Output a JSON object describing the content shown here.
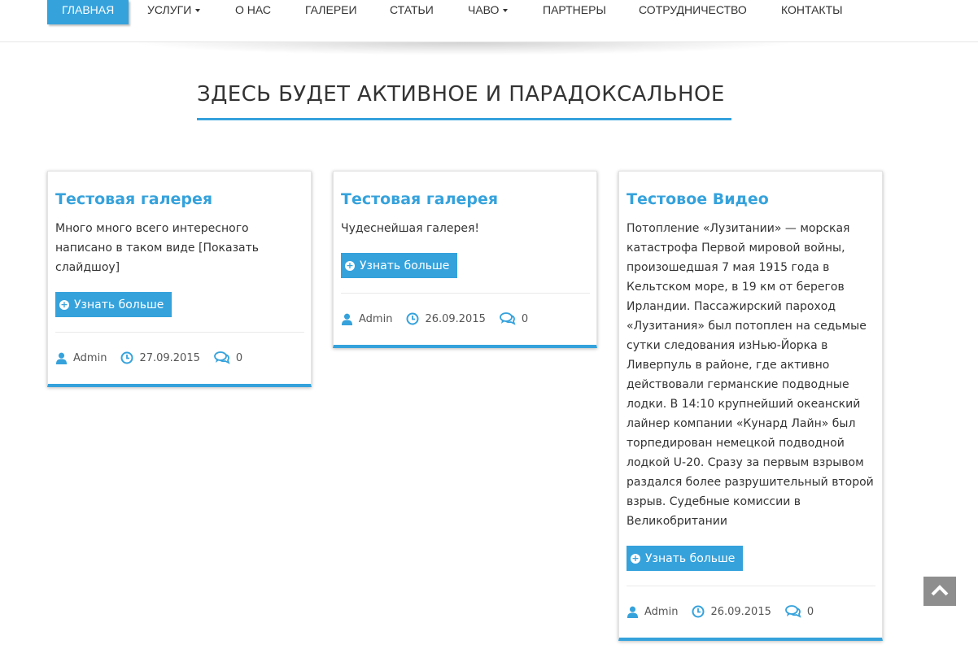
{
  "nav": {
    "items": [
      {
        "label": "ГЛАВНАЯ",
        "active": true,
        "dropdown": false
      },
      {
        "label": "УСЛУГИ",
        "active": false,
        "dropdown": true
      },
      {
        "label": "О НАС",
        "active": false,
        "dropdown": false
      },
      {
        "label": "ГАЛЕРЕИ",
        "active": false,
        "dropdown": false
      },
      {
        "label": "СТАТЬИ",
        "active": false,
        "dropdown": false
      },
      {
        "label": "ЧАВО",
        "active": false,
        "dropdown": true
      },
      {
        "label": "ПАРТНЕРЫ",
        "active": false,
        "dropdown": false
      },
      {
        "label": "СОТРУДНИЧЕСТВО",
        "active": false,
        "dropdown": false
      },
      {
        "label": "КОНТАКТЫ",
        "active": false,
        "dropdown": false
      }
    ]
  },
  "section": {
    "title": "ЗДЕСЬ БУДЕТ АКТИВНОЕ И ПАРАДОКСАЛЬНОЕ"
  },
  "cards": [
    {
      "title": "Тестовая галерея",
      "text": "Много много всего интересного написано в таком виде [Показать слайдшоу]",
      "button": "Узнать больше",
      "author": "Admin",
      "date": "27.09.2015",
      "comments": "0"
    },
    {
      "title": "Тестовая галерея",
      "text": "Чудеснейшая галерея!",
      "button": "Узнать больше",
      "author": "Admin",
      "date": "26.09.2015",
      "comments": "0"
    },
    {
      "title": "Тестовое Видео",
      "text": "Потопление «Лузитании» — морская катастрофа Первой мировой войны, произошедшая 7 мая 1915 года в Кельтском море, в 19 км от берегов Ирландии. Пассажирский пароход «Лузитания» был потоплен на седьмые сутки следования изНью-Йорка в Ливерпуль в районе, где активно действовали германские подводные лодки. В 14:10 крупнейший океанский лайнер компании «Кунард Лайн» был торпедирован немецкой подводной лодкой U-20. Сразу за первым взрывом раздался более разрушительный второй взрыв. Судебные комиссии в Великобритании",
      "button": "Узнать больше",
      "author": "Admin",
      "date": "26.09.2015",
      "comments": "0"
    }
  ],
  "colors": {
    "accent": "#35a2dc",
    "text": "#333333",
    "to_top_button": "#8e8e8e"
  },
  "icons": {
    "user": "user-icon",
    "clock": "clock-icon",
    "comments": "comments-icon",
    "plus": "plus-circle-icon",
    "to_top": "chevron-up-icon"
  }
}
